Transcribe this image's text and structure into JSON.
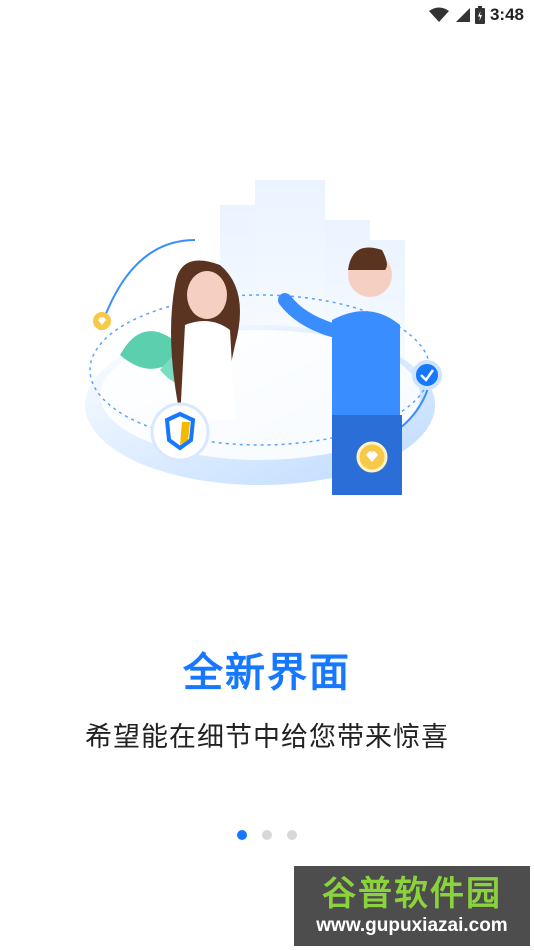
{
  "status_bar": {
    "time": "3:48",
    "icons": [
      "wifi-icon",
      "cell-signal-icon",
      "battery-icon"
    ]
  },
  "illustration": {
    "name": "people-shaking-hands-illustration"
  },
  "onboarding": {
    "title": "全新界面",
    "subtitle": "希望能在细节中给您带来惊喜",
    "page_indicator": {
      "total": 3,
      "current": 1
    }
  },
  "watermark": {
    "title": "谷普软件园",
    "url": "www.gupuxiazai.com"
  },
  "colors": {
    "accent": "#1677ff",
    "dot_inactive": "#d8d8d8"
  }
}
